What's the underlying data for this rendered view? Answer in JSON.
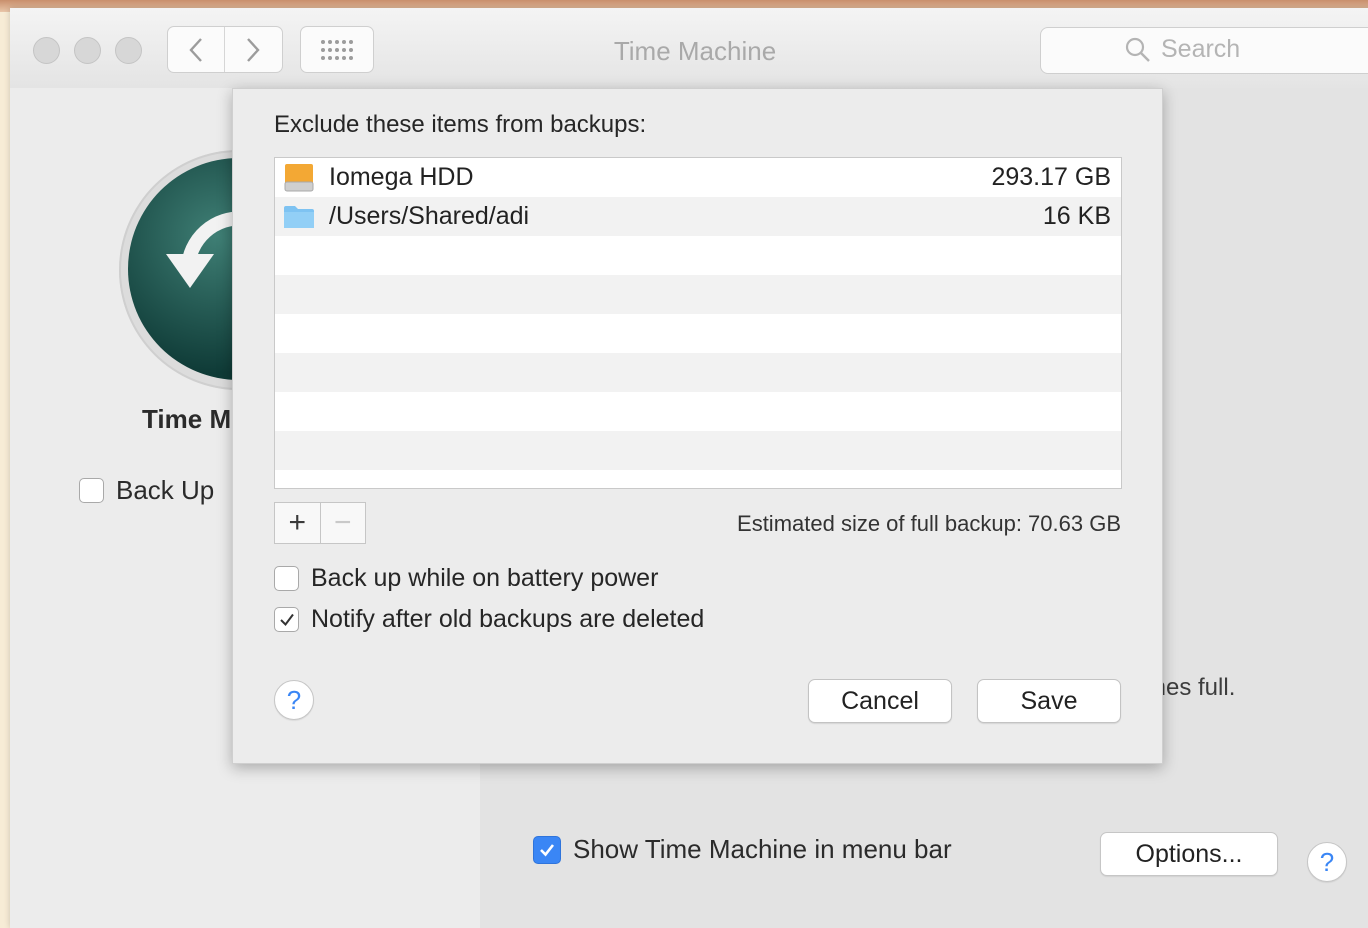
{
  "window": {
    "title": "Time Machine",
    "search_placeholder": "Search"
  },
  "background": {
    "title_partial": "Time M",
    "backup_checkbox_label": "Back Up",
    "backup_checkbox_checked": false,
    "full_text_fragment": "mes full.",
    "show_menubar_label": "Show Time Machine in menu bar",
    "show_menubar_checked": true,
    "options_button": "Options...",
    "help_label": "?"
  },
  "sheet": {
    "heading": "Exclude these items from backups:",
    "items": [
      {
        "name": "Iomega HDD",
        "size": "293.17 GB",
        "icon": "hard-drive-icon"
      },
      {
        "name": "/Users/Shared/adi",
        "size": "16 KB",
        "icon": "folder-icon"
      }
    ],
    "add_label": "+",
    "remove_label": "−",
    "estimate": "Estimated size of full backup: 70.63 GB",
    "battery_label": "Back up while on battery power",
    "battery_checked": false,
    "notify_label": "Notify after old backups are deleted",
    "notify_checked": true,
    "help_label": "?",
    "cancel_label": "Cancel",
    "save_label": "Save"
  },
  "colors": {
    "accent": "#3a86f5",
    "tm_icon": "#0f3b37"
  }
}
